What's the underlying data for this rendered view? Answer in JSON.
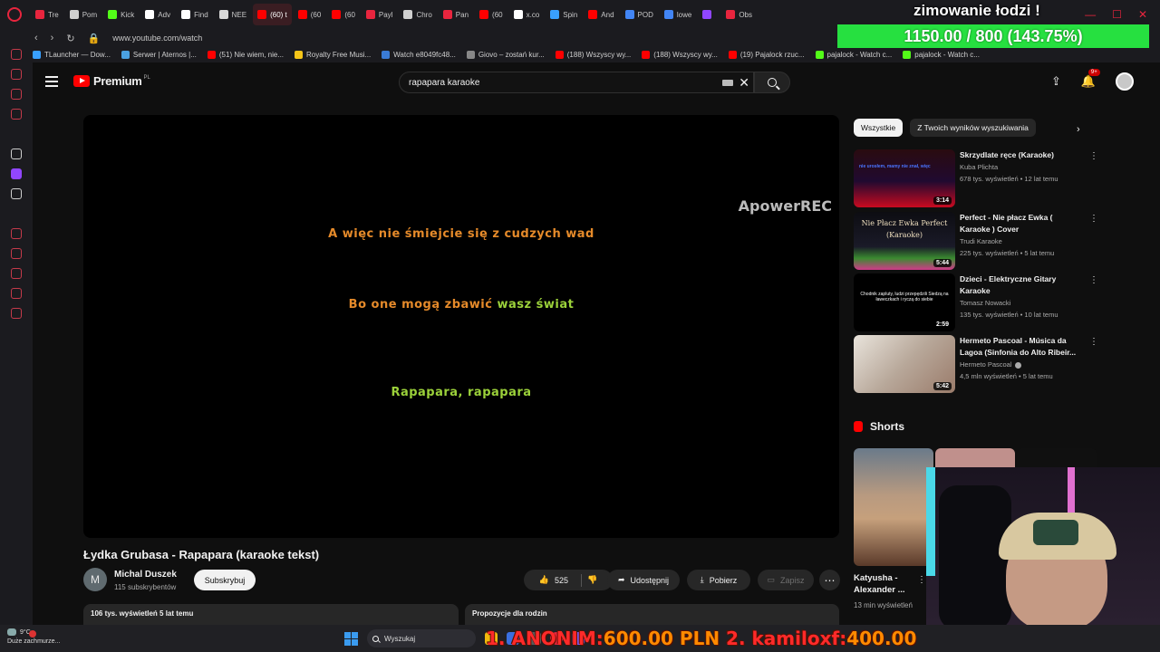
{
  "browser": {
    "tabs": [
      {
        "label": "Tre",
        "color": "#e8253e"
      },
      {
        "label": "Pom",
        "color": "#cfcfcf"
      },
      {
        "label": "Kick",
        "color": "#53fc18"
      },
      {
        "label": "Adv",
        "color": "#ffffff"
      },
      {
        "label": "Find",
        "color": "#ffffff"
      },
      {
        "label": "NEE",
        "color": "#d8d8d8"
      },
      {
        "label": "(60) t",
        "color": "#ff0000",
        "active": true
      },
      {
        "label": "(60",
        "color": "#ff0000"
      },
      {
        "label": "(60",
        "color": "#ff0000"
      },
      {
        "label": "Payl",
        "color": "#e8253e"
      },
      {
        "label": "Chro",
        "color": "#cfcfcf"
      },
      {
        "label": "Pan",
        "color": "#e8253e"
      },
      {
        "label": "(60",
        "color": "#ff0000"
      },
      {
        "label": "x.co",
        "color": "#ffffff"
      },
      {
        "label": "Spin",
        "color": "#39a0ff"
      },
      {
        "label": "And",
        "color": "#ff0000"
      },
      {
        "label": "POD",
        "color": "#4285f4"
      },
      {
        "label": "lowe",
        "color": "#4285f4"
      },
      {
        "label": "",
        "color": "#9146ff"
      },
      {
        "label": "Obs",
        "color": "#e8253e"
      }
    ],
    "url": "www.youtube.com/watch",
    "bookmarks": [
      {
        "label": "TLauncher — Dow...",
        "color": "#39a0ff"
      },
      {
        "label": "Serwer | Aternos |...",
        "color": "#4aa0e0"
      },
      {
        "label": "(51) Nie wiem, nie...",
        "color": "#ff0000"
      },
      {
        "label": "Royalty Free Musi...",
        "color": "#f5c518"
      },
      {
        "label": "Watch e8049fc48...",
        "color": "#3a7bd5"
      },
      {
        "label": "Giovo – zostań kur...",
        "color": "#888888"
      },
      {
        "label": "(188) Wszyscy wy...",
        "color": "#ff0000"
      },
      {
        "label": "(188) Wszyscy wy...",
        "color": "#ff0000"
      },
      {
        "label": "(19) Pajalock rzuc...",
        "color": "#ff0000"
      },
      {
        "label": "pajalock - Watch c...",
        "color": "#53fc18"
      },
      {
        "label": "pajalock - Watch c...",
        "color": "#53fc18"
      }
    ]
  },
  "overlay": {
    "title": "zimowanie łodzi !",
    "goal_text": "1150.00 / 800 (143.75%)",
    "goal_fraction": 1.4375,
    "donation_name": "1. ANONIM:",
    "donation_amount": "600.00 PLN",
    "donation2_name": "2. kamiloxf:",
    "donation2_amount": "400.00"
  },
  "youtube": {
    "logo_text": "Premium",
    "logo_sup": "PL",
    "search_value": "rapapara karaoke",
    "notif_badge": "9+"
  },
  "player": {
    "watermark": "ApowerREC",
    "lyric1": "A więc nie śmiejcie się z cudzych wad",
    "lyric2a": "Bo one mogą zbawić ",
    "lyric2b": "wasz świat",
    "lyric3": "Rapapara, rapapara"
  },
  "video": {
    "title": "Łydka Grubasa - Rapapara (karaoke tekst)",
    "channel_initial": "M",
    "channel_name": "Michal Duszek",
    "channel_subs": "115 subskrybentów",
    "subscribe_label": "Subskrybuj",
    "likes": "525",
    "share_label": "Udostępnij",
    "download_label": "Pobierz",
    "save_label": "Zapisz",
    "views_meta": "106 tys. wyświetleń  5 lat temu",
    "family_label": "Propozycje dla rodzin"
  },
  "sidebar_chips": [
    "Wszystkie",
    "Z Twoich wyników wyszukiwania"
  ],
  "recommendations": [
    {
      "title": "Skrzydlate ręce (Karaoke)",
      "channel": "Kuba Plichta",
      "meta": "678 tys. wyświetleń • 12 lat temu",
      "duration": "3:14"
    },
    {
      "title": "Perfect  - Nie płacz Ewka ( Karaoke ) Cover",
      "channel": "Trudi Karaoke",
      "meta": "225 tys. wyświetleń • 5 lat temu",
      "duration": "5:44",
      "thumb_text": "Nie Płacz Ewka Perfect (Karaoke)"
    },
    {
      "title": "Dzieci - Elektryczne Gitary Karaoke",
      "channel": "Tomasz Nowacki",
      "meta": "135 tys. wyświetleń • 10 lat temu",
      "duration": "2:59",
      "thumb_text": "Chodnik zapluty, ludzi przepędzili Siedzą na ławeczkach i ryczą do siebie"
    },
    {
      "title": "Hermeto Pascoal - Música da Lagoa (Sinfonia do Alto Ribeir...",
      "channel": "Hermeto Pascoal",
      "meta": "4,5 mln wyświetleń • 5 lat temu",
      "duration": "5:42"
    }
  ],
  "shorts": {
    "header": "Shorts",
    "first_title": "Katyusha - Alexander ...",
    "first_views": "13 min wyświetleń"
  },
  "taskbar": {
    "weather_temp": "9°C",
    "weather_text": "Duże zachmurze...",
    "search_label": "Wyszukaj"
  }
}
